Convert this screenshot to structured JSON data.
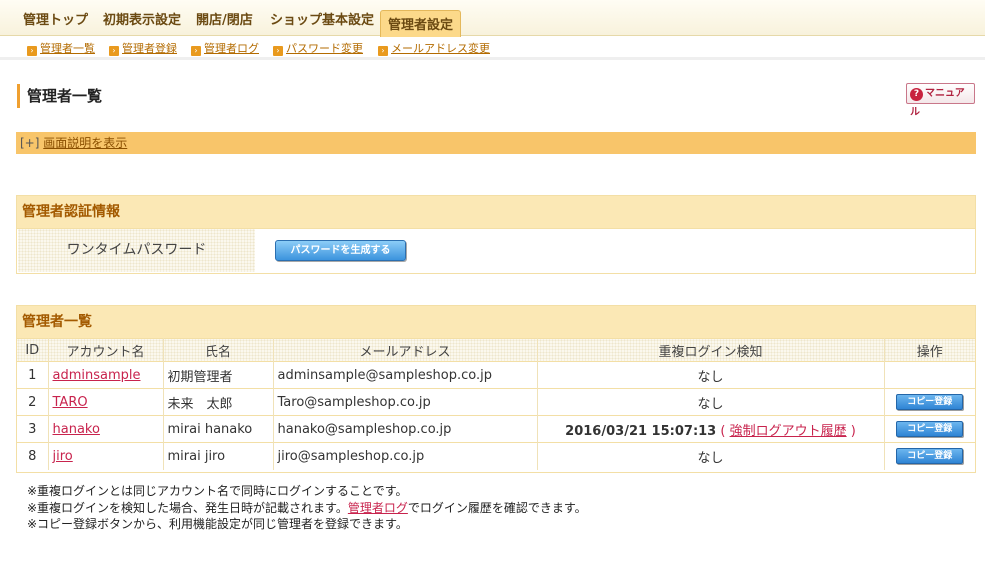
{
  "top_tabs": [
    "管理トップ",
    "初期表示設定",
    "開店/閉店",
    "ショップ基本設定",
    "管理者設定"
  ],
  "sub_nav": [
    "管理者一覧",
    "管理者登録",
    "管理者ログ",
    "パスワード変更",
    "メールアドレス変更"
  ],
  "page_title": "管理者一覧",
  "manual_button": "マニュアル",
  "explain": {
    "prefix": "[+]",
    "link": "画面説明を表示"
  },
  "auth_section": {
    "title": "管理者認証情報",
    "onetime_label": "ワンタイムパスワード",
    "generate_button": "パスワードを生成する"
  },
  "admin_section": {
    "title": "管理者一覧",
    "columns": [
      "ID",
      "アカウント名",
      "氏名",
      "メールアドレス",
      "重複ログイン検知",
      "操作"
    ],
    "copy_button": "コピー登録",
    "rows": [
      {
        "id": "1",
        "account": "adminsample",
        "name": "初期管理者",
        "email": "adminsample@sampleshop.co.jp",
        "dup": "なし",
        "copy": false
      },
      {
        "id": "2",
        "account": "TARO",
        "name": "未来　太郎",
        "email": "Taro@sampleshop.co.jp",
        "dup": "なし",
        "copy": true
      },
      {
        "id": "3",
        "account": "hanako",
        "name": "mirai hanako",
        "email": "hanako@sampleshop.co.jp",
        "dup_time": "2016/03/21 15:07:13",
        "dup_link": "強制ログアウト履歴",
        "copy": true
      },
      {
        "id": "8",
        "account": "jiro",
        "name": "mirai jiro",
        "email": "jiro@sampleshop.co.jp",
        "dup": "なし",
        "copy": true
      }
    ]
  },
  "notes": {
    "line1": "※重複ログインとは同じアカウント名で同時にログインすることです。",
    "line2_pre": "※重複ログインを検知した場合、発生日時が記載されます。",
    "line2_link": "管理者ログ",
    "line2_post": "でログイン履歴を確認できます。",
    "line3": "※コピー登録ボタンから、利用機能設定が同じ管理者を登録できます。"
  }
}
